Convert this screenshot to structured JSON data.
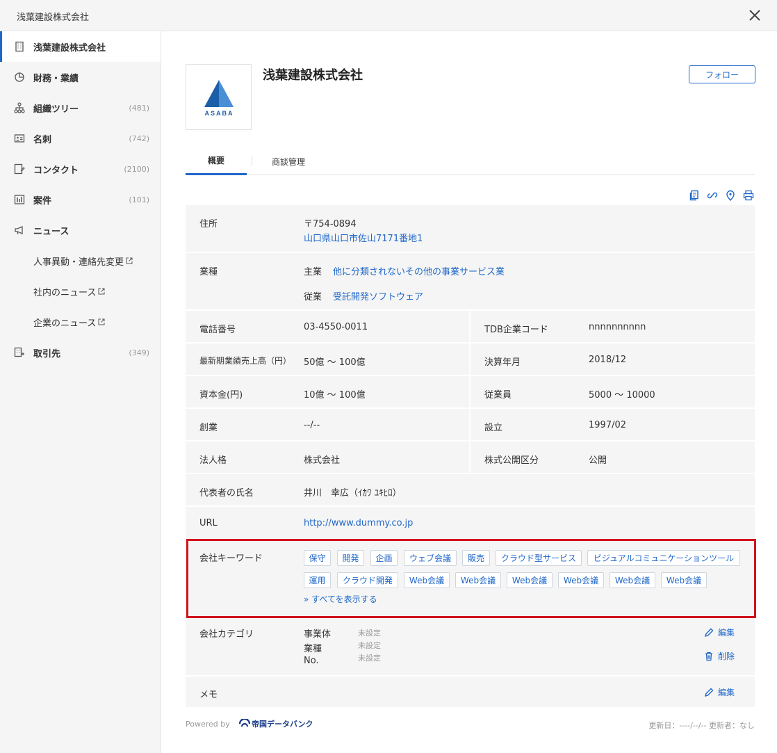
{
  "window": {
    "title": "浅葉建設株式会社"
  },
  "sidebar": {
    "items": [
      {
        "label": "浅葉建設株式会社",
        "count": ""
      },
      {
        "label": "財務・業績",
        "count": ""
      },
      {
        "label": "組織ツリー",
        "count": "(481)"
      },
      {
        "label": "名刺",
        "count": "(742)"
      },
      {
        "label": "コンタクト",
        "count": "(2100)"
      },
      {
        "label": "案件",
        "count": "(101)"
      },
      {
        "label": "ニュース",
        "count": ""
      },
      {
        "label": "取引先",
        "count": "(349)"
      }
    ],
    "news_sub": [
      "人事異動・連絡先変更",
      "社内のニュース",
      "企業のニュース"
    ]
  },
  "header": {
    "company_name": "浅葉建設株式会社",
    "logo_text": "ASABA",
    "follow_label": "フォロー"
  },
  "tabs": [
    "概要",
    "商談管理"
  ],
  "details": {
    "address": {
      "label": "住所",
      "postal": "〒754-0894",
      "address": "山口県山口市佐山7171番地1"
    },
    "industry": {
      "label": "業種",
      "main_label": "主業",
      "main_value": "他に分類されないその他の事業サービス業",
      "sub_label": "従業",
      "sub_value": "受託開発ソフトウェア"
    },
    "phone": {
      "label": "電話番号",
      "value": "03-4550-0011"
    },
    "tdb": {
      "label": "TDB企業コード",
      "value": "nnnnnnnnnn"
    },
    "sales": {
      "label": "最新期業績売上高（円）",
      "value": "50億 〜 100億"
    },
    "fiscal": {
      "label": "決算年月",
      "value": "2018/12"
    },
    "capital": {
      "label": "資本金(円)",
      "value": "10億 〜 100億"
    },
    "employees": {
      "label": "従業員",
      "value": "5000 〜 10000"
    },
    "founded": {
      "label": "創業",
      "value": "--/--"
    },
    "established": {
      "label": "設立",
      "value": "1997/02"
    },
    "corp_type": {
      "label": "法人格",
      "value": "株式会社"
    },
    "listing": {
      "label": "株式公開区分",
      "value": "公開"
    },
    "representative": {
      "label": "代表者の氏名",
      "value": "井川　幸広（ｲｶﾜ ﾕｷﾋﾛ）"
    },
    "url": {
      "label": "URL",
      "value": "http://www.dummy.co.jp"
    },
    "keywords": {
      "label": "会社キーワード",
      "tags_row1": [
        "保守",
        "開発",
        "企画",
        "ウェブ会議",
        "販売",
        "クラウド型サービス",
        "ビジュアルコミュニケーションツール"
      ],
      "tags_row2": [
        "運用",
        "クラウド開発",
        "Web会議",
        "Web会議",
        "Web会議",
        "Web会議",
        "Web会議",
        "Web会議"
      ],
      "show_all": "» すべてを表示する"
    },
    "category": {
      "label": "会社カテゴリ",
      "fields": [
        "事業体",
        "業種",
        "No."
      ],
      "unset": "未設定",
      "edit_label": "編集",
      "delete_label": "削除"
    },
    "memo": {
      "label": "メモ",
      "edit_label": "編集"
    }
  },
  "footer": {
    "powered_by": "Powered by",
    "brand": "帝国データバンク",
    "updated": "更新日：----/--/-- 更新者：なし"
  },
  "colors": {
    "accent": "#1f67c9",
    "highlight": "#d0121b",
    "logo": "#1b5fa8"
  }
}
